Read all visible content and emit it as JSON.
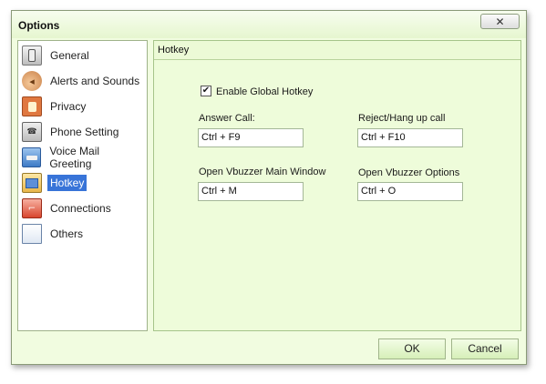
{
  "window": {
    "title": "Options",
    "close_glyph": "✕"
  },
  "sidebar": {
    "items": [
      {
        "label": "General",
        "icon": "general-icon",
        "selected": false
      },
      {
        "label": "Alerts and Sounds",
        "icon": "speaker-icon",
        "selected": false
      },
      {
        "label": "Privacy",
        "icon": "privacy-icon",
        "selected": false
      },
      {
        "label": "Phone Setting",
        "icon": "phone-icon",
        "selected": false
      },
      {
        "label": "Voice Mail Greeting",
        "icon": "voicemail-icon",
        "selected": false
      },
      {
        "label": "Hotkey",
        "icon": "hotkey-icon",
        "selected": true
      },
      {
        "label": "Connections",
        "icon": "connections-icon",
        "selected": false
      },
      {
        "label": "Others",
        "icon": "document-icon",
        "selected": false
      }
    ]
  },
  "panel": {
    "title": "Hotkey",
    "enable_checkbox": {
      "label": "Enable Global Hotkey",
      "checked": true,
      "glyph": "✔"
    },
    "answer_call": {
      "label": "Answer Call:",
      "value": "Ctrl + F9"
    },
    "reject_call": {
      "label": "Reject/Hang up call",
      "value": "Ctrl + F10"
    },
    "open_main": {
      "label": "Open Vbuzzer Main Window",
      "value": "Ctrl + M"
    },
    "open_options": {
      "label": "Open Vbuzzer Options",
      "value": "Ctrl + O"
    }
  },
  "buttons": {
    "ok": "OK",
    "cancel": "Cancel"
  },
  "colors": {
    "window_bg": "#f1fce0",
    "selected": "#3874d8",
    "border": "#a6c48a"
  }
}
